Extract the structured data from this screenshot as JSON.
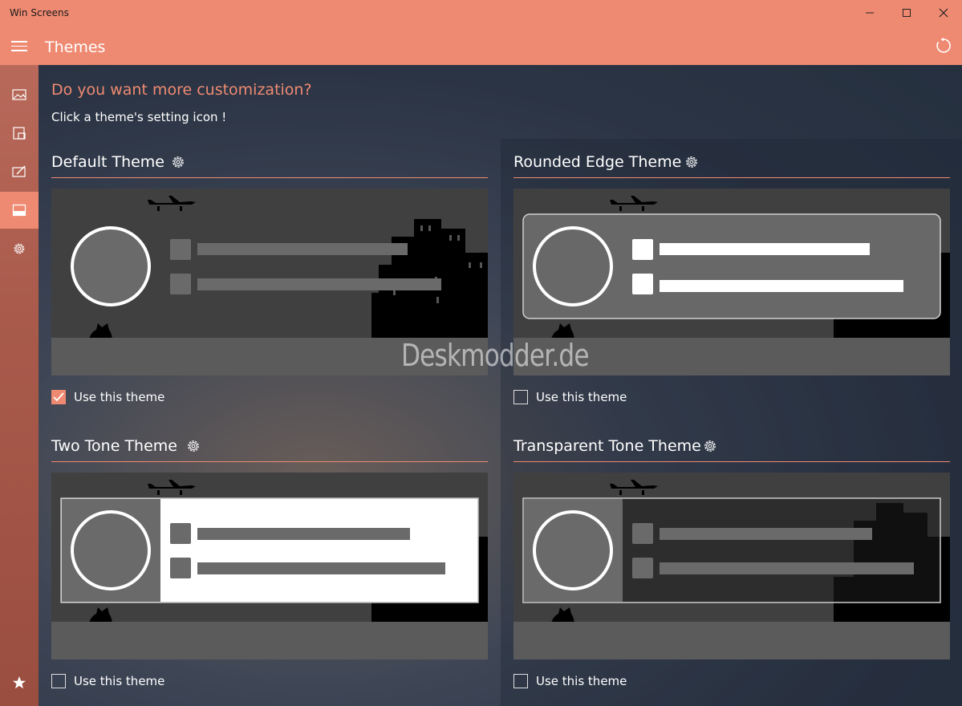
{
  "window": {
    "title": "Win Screens",
    "controls": [
      "minimize-icon",
      "maximize-icon",
      "close-icon"
    ]
  },
  "appbar": {
    "title": "Themes",
    "menu_icon": "hamburger-icon",
    "refresh_icon": "refresh-icon"
  },
  "sidebar": {
    "items": [
      {
        "icon": "image-icon",
        "active": false
      },
      {
        "icon": "screens-icon",
        "active": false
      },
      {
        "icon": "edit-icon",
        "active": false
      },
      {
        "icon": "themes-icon",
        "active": true
      },
      {
        "icon": "settings-icon",
        "active": false
      }
    ],
    "footer_icon": "star-icon"
  },
  "main": {
    "heading": "Do you want more customization?",
    "subheading": "Click a theme's setting icon !",
    "themes": [
      {
        "name": "Default Theme",
        "checkbox_label": "Use this theme",
        "checked": true
      },
      {
        "name": "Rounded Edge Theme",
        "checkbox_label": "Use this theme",
        "checked": false
      },
      {
        "name": "Two Tone Theme",
        "checkbox_label": "Use this theme",
        "checked": false
      },
      {
        "name": "Transparent Tone Theme",
        "checkbox_label": "Use this theme",
        "checked": false
      }
    ]
  },
  "watermark": "Deskmodder.de",
  "colors": {
    "accent": "#ef8a72",
    "preview_bg": "#404040",
    "preview_ground": "#5b5b5b",
    "placeholder": "#6a6a6a"
  }
}
